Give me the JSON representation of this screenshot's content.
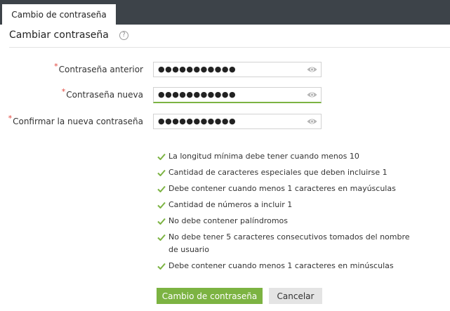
{
  "tab": {
    "label": "Cambio de contraseña"
  },
  "header": {
    "title": "Cambiar contraseña",
    "help_icon": "?"
  },
  "form": {
    "required_mark": "*",
    "fields": [
      {
        "label": "Contraseña anterior",
        "value": "●●●●●●●●●●●"
      },
      {
        "label": "Contraseña nueva",
        "value": "●●●●●●●●●●●"
      },
      {
        "label": "Confirmar la nueva contraseña",
        "value": "●●●●●●●●●●●"
      }
    ]
  },
  "rules": [
    "La longitud mínima debe tener cuando menos 10",
    "Cantidad de caracteres especiales que deben incluirse 1",
    "Debe contener cuando menos 1 caracteres en mayúsculas",
    "Cantidad de números a incluir 1",
    "No debe contener palíndromos",
    "No debe tener 5 caracteres consecutivos tomados del nombre de usuario",
    "Debe contener cuando menos 1 caracteres en minúsculas"
  ],
  "buttons": {
    "submit": "Cambio de contraseña",
    "cancel": "Cancelar"
  },
  "colors": {
    "accent": "#7cb342",
    "required": "#e2453c",
    "topbar": "#3d4349"
  }
}
